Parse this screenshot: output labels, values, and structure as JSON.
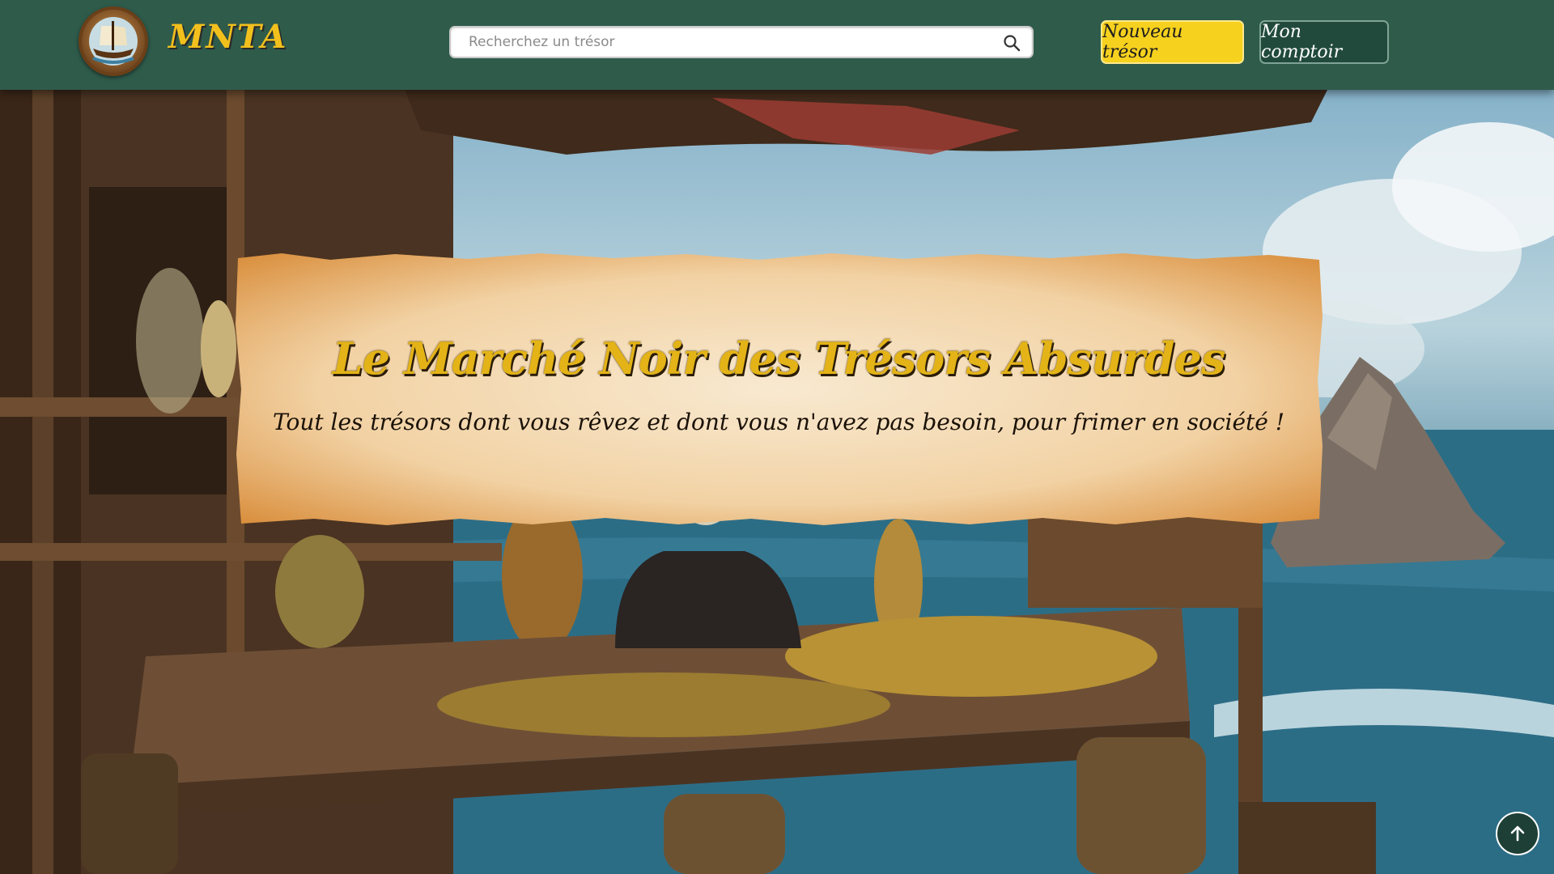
{
  "header": {
    "logo_text": "MNTA",
    "search": {
      "placeholder": "Recherchez un trésor",
      "value": ""
    },
    "new_treasure_label": "Nouveau trésor",
    "account_label": "Mon comptoir"
  },
  "hero": {
    "title": "Le Marché Noir des Trésors Absurdes",
    "subtitle": "Tout les trésors dont vous rêvez et dont vous n'avez pas besoin, pour frimer en société !"
  },
  "icons": {
    "search": "search-icon",
    "scroll_top": "arrow-up-icon",
    "logo": "pirate-ship-emblem-icon"
  },
  "colors": {
    "header_bg": "#2f5b4b",
    "accent_yellow": "#f6d11e",
    "account_btn_bg": "#214a3c",
    "title_gold": "#e3b317"
  }
}
